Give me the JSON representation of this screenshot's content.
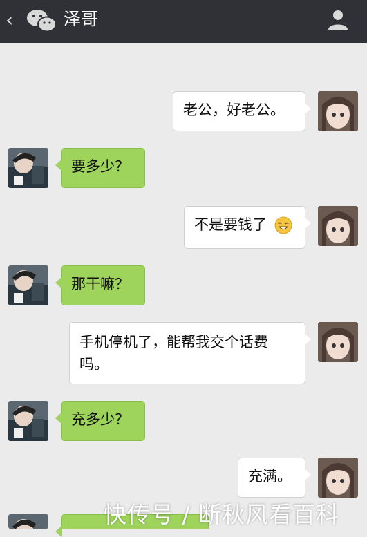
{
  "header": {
    "back_glyph": "‹",
    "title": "泽哥"
  },
  "messages": [
    {
      "side": "right",
      "text": "老公，好老公。"
    },
    {
      "side": "left",
      "text": "要多少？"
    },
    {
      "side": "right",
      "text": "不是要钱了"
    },
    {
      "side": "left",
      "text": "那干嘛？"
    },
    {
      "side": "right",
      "text": "手机停机了，能帮我交个话费吗。"
    },
    {
      "side": "left",
      "text": "充多少？"
    },
    {
      "side": "right",
      "text": "充满。"
    }
  ],
  "watermark": "快传号 / 断秋风看百科",
  "colors": {
    "topbar": "#2f3136",
    "background": "#ebebeb",
    "green_bubble": "#9ed45c",
    "white_bubble": "#ffffff"
  }
}
